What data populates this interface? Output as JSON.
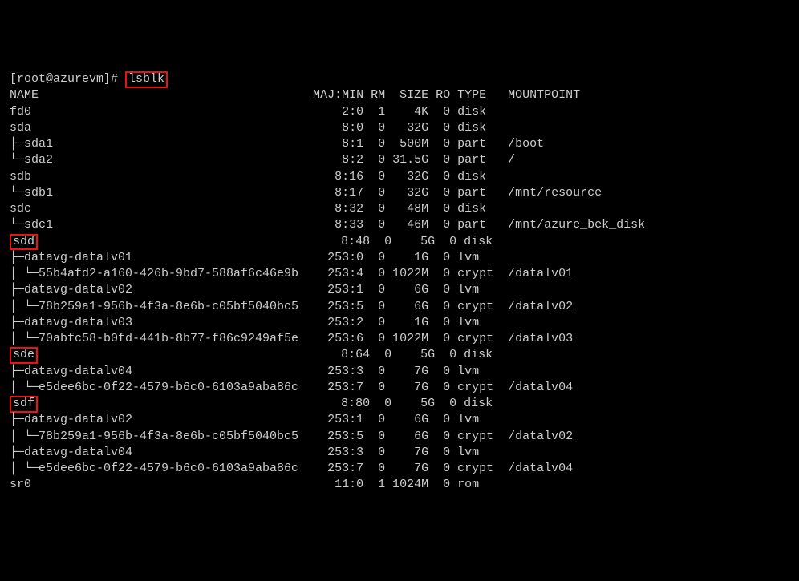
{
  "prompt": "[root@azurevm]#",
  "command": "lsblk",
  "headers": {
    "name": "NAME",
    "maj_min": "MAJ:MIN",
    "rm": "RM",
    "size": "SIZE",
    "ro": "RO",
    "type": "TYPE",
    "mount": "MOUNTPOINT"
  },
  "rows": [
    {
      "prefix": "",
      "name": "fd0",
      "hl": false,
      "maj": "2:0",
      "rm": "1",
      "size": "4K",
      "ro": "0",
      "type": "disk",
      "mount": ""
    },
    {
      "prefix": "",
      "name": "sda",
      "hl": false,
      "maj": "8:0",
      "rm": "0",
      "size": "32G",
      "ro": "0",
      "type": "disk",
      "mount": ""
    },
    {
      "prefix": "├─",
      "name": "sda1",
      "hl": false,
      "maj": "8:1",
      "rm": "0",
      "size": "500M",
      "ro": "0",
      "type": "part",
      "mount": "/boot"
    },
    {
      "prefix": "└─",
      "name": "sda2",
      "hl": false,
      "maj": "8:2",
      "rm": "0",
      "size": "31.5G",
      "ro": "0",
      "type": "part",
      "mount": "/"
    },
    {
      "prefix": "",
      "name": "sdb",
      "hl": false,
      "maj": "8:16",
      "rm": "0",
      "size": "32G",
      "ro": "0",
      "type": "disk",
      "mount": ""
    },
    {
      "prefix": "└─",
      "name": "sdb1",
      "hl": false,
      "maj": "8:17",
      "rm": "0",
      "size": "32G",
      "ro": "0",
      "type": "part",
      "mount": "/mnt/resource"
    },
    {
      "prefix": "",
      "name": "sdc",
      "hl": false,
      "maj": "8:32",
      "rm": "0",
      "size": "48M",
      "ro": "0",
      "type": "disk",
      "mount": ""
    },
    {
      "prefix": "└─",
      "name": "sdc1",
      "hl": false,
      "maj": "8:33",
      "rm": "0",
      "size": "46M",
      "ro": "0",
      "type": "part",
      "mount": "/mnt/azure_bek_disk"
    },
    {
      "prefix": "",
      "name": "sdd",
      "hl": true,
      "maj": "8:48",
      "rm": "0",
      "size": "5G",
      "ro": "0",
      "type": "disk",
      "mount": ""
    },
    {
      "prefix": "├─",
      "name": "datavg-datalv01",
      "hl": false,
      "maj": "253:0",
      "rm": "0",
      "size": "1G",
      "ro": "0",
      "type": "lvm",
      "mount": ""
    },
    {
      "prefix": "│ └─",
      "name": "55b4afd2-a160-426b-9bd7-588af6c46e9b",
      "hl": false,
      "maj": "253:4",
      "rm": "0",
      "size": "1022M",
      "ro": "0",
      "type": "crypt",
      "mount": "/datalv01"
    },
    {
      "prefix": "├─",
      "name": "datavg-datalv02",
      "hl": false,
      "maj": "253:1",
      "rm": "0",
      "size": "6G",
      "ro": "0",
      "type": "lvm",
      "mount": ""
    },
    {
      "prefix": "│ └─",
      "name": "78b259a1-956b-4f3a-8e6b-c05bf5040bc5",
      "hl": false,
      "maj": "253:5",
      "rm": "0",
      "size": "6G",
      "ro": "0",
      "type": "crypt",
      "mount": "/datalv02"
    },
    {
      "prefix": "├─",
      "name": "datavg-datalv03",
      "hl": false,
      "maj": "253:2",
      "rm": "0",
      "size": "1G",
      "ro": "0",
      "type": "lvm",
      "mount": ""
    },
    {
      "prefix": "│ └─",
      "name": "70abfc58-b0fd-441b-8b77-f86c9249af5e",
      "hl": false,
      "maj": "253:6",
      "rm": "0",
      "size": "1022M",
      "ro": "0",
      "type": "crypt",
      "mount": "/datalv03"
    },
    {
      "prefix": "",
      "name": "sde",
      "hl": true,
      "maj": "8:64",
      "rm": "0",
      "size": "5G",
      "ro": "0",
      "type": "disk",
      "mount": ""
    },
    {
      "prefix": "├─",
      "name": "datavg-datalv04",
      "hl": false,
      "maj": "253:3",
      "rm": "0",
      "size": "7G",
      "ro": "0",
      "type": "lvm",
      "mount": ""
    },
    {
      "prefix": "│ └─",
      "name": "e5dee6bc-0f22-4579-b6c0-6103a9aba86c",
      "hl": false,
      "maj": "253:7",
      "rm": "0",
      "size": "7G",
      "ro": "0",
      "type": "crypt",
      "mount": "/datalv04"
    },
    {
      "prefix": "",
      "name": "sdf",
      "hl": true,
      "maj": "8:80",
      "rm": "0",
      "size": "5G",
      "ro": "0",
      "type": "disk",
      "mount": ""
    },
    {
      "prefix": "├─",
      "name": "datavg-datalv02",
      "hl": false,
      "maj": "253:1",
      "rm": "0",
      "size": "6G",
      "ro": "0",
      "type": "lvm",
      "mount": ""
    },
    {
      "prefix": "│ └─",
      "name": "78b259a1-956b-4f3a-8e6b-c05bf5040bc5",
      "hl": false,
      "maj": "253:5",
      "rm": "0",
      "size": "6G",
      "ro": "0",
      "type": "crypt",
      "mount": "/datalv02"
    },
    {
      "prefix": "├─",
      "name": "datavg-datalv04",
      "hl": false,
      "maj": "253:3",
      "rm": "0",
      "size": "7G",
      "ro": "0",
      "type": "lvm",
      "mount": ""
    },
    {
      "prefix": "│ └─",
      "name": "e5dee6bc-0f22-4579-b6c0-6103a9aba86c",
      "hl": false,
      "maj": "253:7",
      "rm": "0",
      "size": "7G",
      "ro": "0",
      "type": "crypt",
      "mount": "/datalv04"
    },
    {
      "prefix": "",
      "name": "sr0",
      "hl": false,
      "maj": "11:0",
      "rm": "1",
      "size": "1024M",
      "ro": "0",
      "type": "rom",
      "mount": ""
    }
  ]
}
